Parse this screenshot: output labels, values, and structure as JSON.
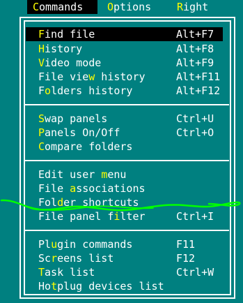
{
  "menubar": {
    "items": [
      {
        "pre": "",
        "hot": "C",
        "post": "ommands",
        "selected": true
      },
      {
        "pre": "",
        "hot": "O",
        "post": "ptions",
        "selected": false
      },
      {
        "pre": "",
        "hot": "R",
        "post": "ight",
        "selected": false
      }
    ]
  },
  "menu": {
    "groups": [
      [
        {
          "pre": "",
          "hot": "F",
          "post": "ind file",
          "shortcut": "Alt+F7",
          "selected": true
        },
        {
          "pre": "",
          "hot": "H",
          "post": "istory",
          "shortcut": "Alt+F8",
          "selected": false
        },
        {
          "pre": "",
          "hot": "V",
          "post": "ideo mode",
          "shortcut": "Alt+F9",
          "selected": false
        },
        {
          "pre": "File vie",
          "hot": "w",
          "post": " history",
          "shortcut": "Alt+F11",
          "selected": false
        },
        {
          "pre": "F",
          "hot": "o",
          "post": "lders history",
          "shortcut": "Alt+F12",
          "selected": false
        }
      ],
      [
        {
          "pre": "",
          "hot": "S",
          "post": "wap panels",
          "shortcut": "Ctrl+U",
          "selected": false
        },
        {
          "pre": "",
          "hot": "P",
          "post": "anels On/Off",
          "shortcut": "Ctrl+O",
          "selected": false
        },
        {
          "pre": "",
          "hot": "C",
          "post": "ompare folders",
          "shortcut": "",
          "selected": false
        }
      ],
      [
        {
          "pre": "Edit user ",
          "hot": "m",
          "post": "enu",
          "shortcut": "",
          "selected": false
        },
        {
          "pre": "File ",
          "hot": "a",
          "post": "ssociations",
          "shortcut": "",
          "selected": false
        },
        {
          "pre": "Fol",
          "hot": "d",
          "post": "er shortcuts",
          "shortcut": "",
          "selected": false
        },
        {
          "pre": "File panel f",
          "hot": "i",
          "post": "lter",
          "shortcut": "Ctrl+I",
          "selected": false
        }
      ],
      [
        {
          "pre": "Pl",
          "hot": "u",
          "post": "gin commands",
          "shortcut": "F11",
          "selected": false
        },
        {
          "pre": "Sc",
          "hot": "r",
          "post": "eens list",
          "shortcut": "F12",
          "selected": false
        },
        {
          "pre": "",
          "hot": "T",
          "post": "ask list",
          "shortcut": "Ctrl+W",
          "selected": false
        },
        {
          "pre": "Ho",
          "hot": "t",
          "post": "plug devices list",
          "shortcut": "",
          "selected": false
        }
      ]
    ]
  },
  "colors": {
    "background": "#008080",
    "text": "#ffffff",
    "hotkey": "#ffff00",
    "selection": "#000000",
    "scribble": "#00ff00"
  }
}
